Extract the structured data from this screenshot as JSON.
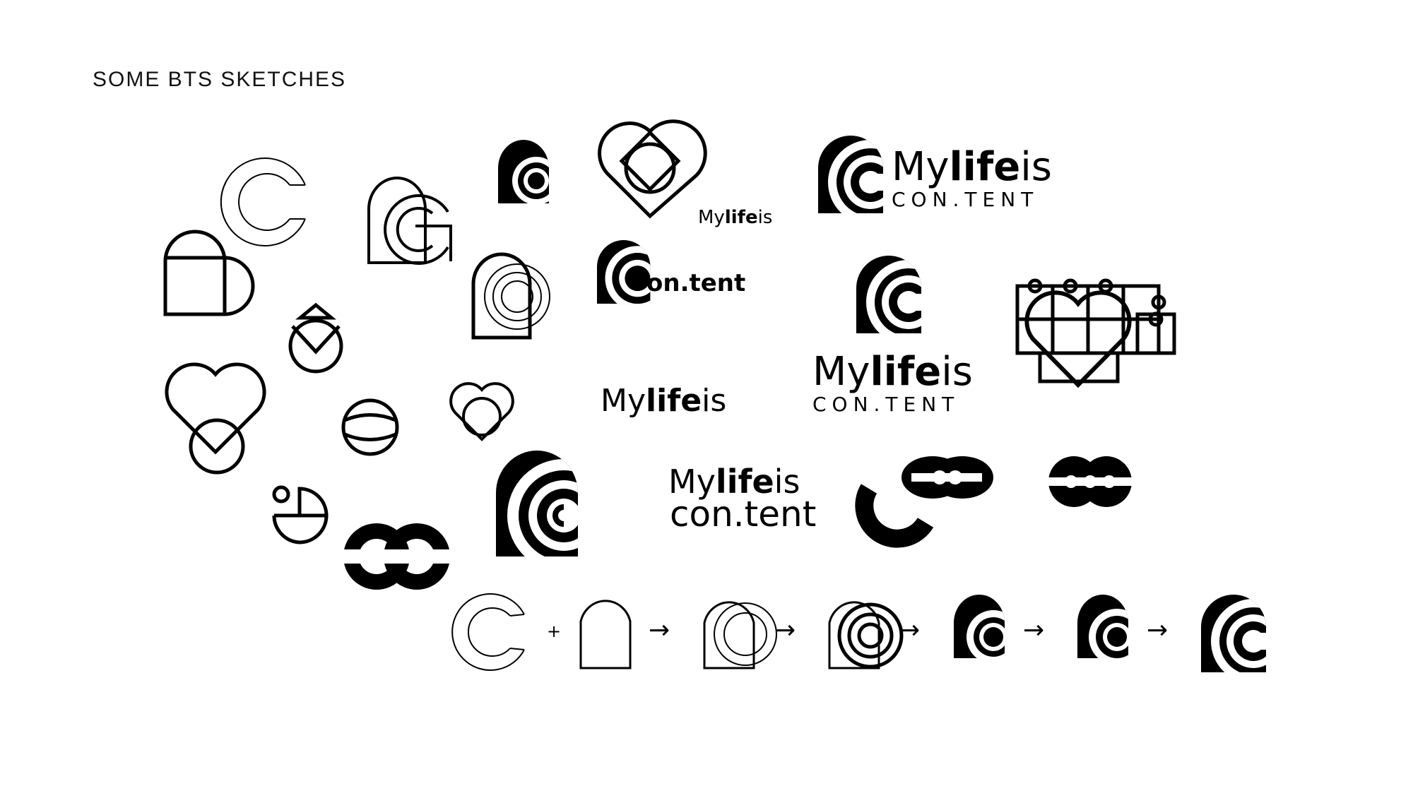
{
  "page": {
    "title": "SOME BTS SKETCHES",
    "ink_color": "#000000",
    "background_color": "#ffffff"
  },
  "wordmarks": {
    "my": "My",
    "life": "life",
    "is": "is",
    "content_spaced": "CON.TENT",
    "content_lower": "con.tent",
    "on_tent": "on.tent"
  },
  "process_row": {
    "plus": "+",
    "arrow": "→"
  }
}
